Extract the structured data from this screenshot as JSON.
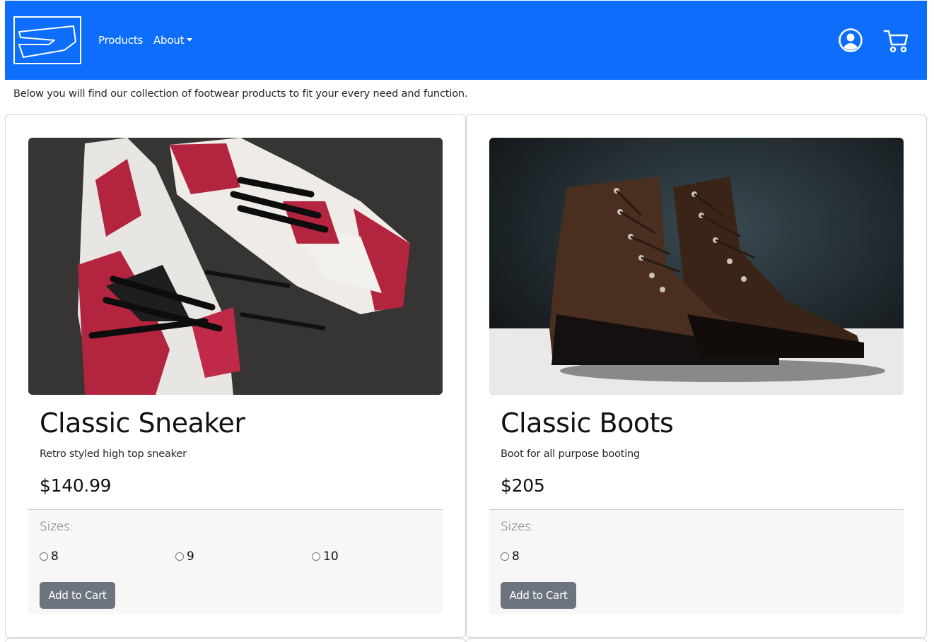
{
  "nav": {
    "products_label": "Products",
    "about_label": "About",
    "brand_color": "#0d6efd"
  },
  "intro_text": "Below you will find our collection of footwear products to fit your every need and function.",
  "products": [
    {
      "title": "Classic Sneaker",
      "description": "Retro styled high top sneaker",
      "price": "$140.99",
      "sizes_label": "Sizes:",
      "sizes": [
        "8",
        "9",
        "10"
      ],
      "button_label": "Add to Cart"
    },
    {
      "title": "Classic Boots",
      "description": "Boot for all purpose booting",
      "price": "$205",
      "sizes_label": "Sizes:",
      "sizes": [
        "8"
      ],
      "button_label": "Add to Cart"
    }
  ],
  "icons": {
    "user": "user-circle-icon",
    "cart": "shopping-cart-icon",
    "caret": "caret-down-icon"
  },
  "colors": {
    "button": "#6c757d",
    "footer_bg": "#f7f7f7"
  }
}
